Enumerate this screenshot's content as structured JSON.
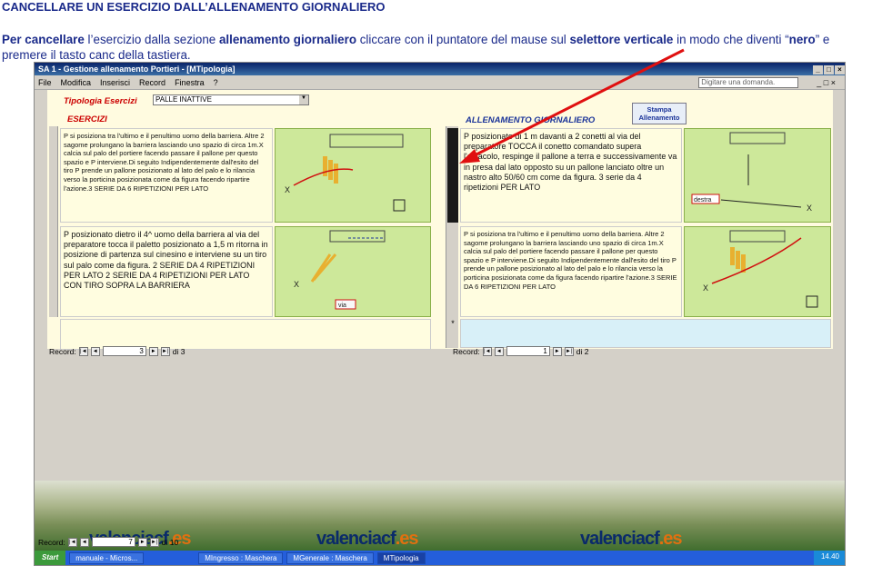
{
  "heading": "CANCELLARE UN ESERCIZIO DALL’ALLENAMENTO GIORNALIERO",
  "intro": {
    "p1": "Per cancellare",
    "p2": " l’esercizio dalla sezione ",
    "p3": "allenamento giornaliero",
    "p4": " cliccare con il puntatore del mause  sul ",
    "p5": "selettore verticale",
    "p6": " in modo che diventi “",
    "p7": "nero",
    "p8": "” e premere il tasto canc della tastiera."
  },
  "window": {
    "title": "SA 1 - Gestione allenamento Portieri - [MTipologia]",
    "menu": [
      "File",
      "Modifica",
      "Inserisci",
      "Record",
      "Finestra",
      "?"
    ],
    "help_placeholder": "Digitare una domanda."
  },
  "form": {
    "tipologia_label": "Tipologia Esercizi",
    "tipologia_value": "PALLE INATTIVE",
    "esercizi_label": "ESERCIZI",
    "allenamento_label": "ALLENAMENTO GIORNALIERO",
    "stampa_button": "Stampa Allenamento",
    "left_cells": [
      "P si posiziona tra l'ultimo e il penultimo uomo della barriera. Altre 2 sagome prolungano la barriera lasciando uno spazio di circa 1m.X calcia sul palo del portiere facendo passare il pallone per questo spazio e P interviene.Di seguito Indipendentemente dall'esito del tiro P prende un pallone posizionato al lato del palo e lo rilancia verso la porticina posizionata come da figura facendo ripartire l'azione.3 SERIE DA 6 RIPETIZIONI PER LATO",
      "P posizionato dietro il 4^ uomo della barriera al via del preparatore tocca il paletto posizionato a 1,5 m ritorna in posizione di partenza sul cinesino e interviene su un tiro sul palo come da figura. 2 SERIE DA 4 RIPETIZIONI PER LATO 2 SERIE DA 4 RIPETIZIONI PER LATO CON TIRO SOPRA LA BARRIERA"
    ],
    "right_cells": [
      "P posizionato di 1 m davanti a 2 conetti al via del preparatore TOCCA il conetto comandato supera l'ostacolo, respinge il pallone a terra e successivamente va in presa dal lato opposto su un pallone lanciato oltre un nastro alto 50/60 cm come da figura. 3 serie da 4 ripetizioni PER LATO",
      "P si posiziona tra l'ultimo e il penultimo uomo della barriera. Altre 2 sagome prolungano la barriera lasciando uno spazio di circa 1m.X calcia sul palo del portiere facendo passare il pallone per questo spazio e P interviene.Di seguito Indipendentemente dall'esito del tiro P prende un pallone posizionato al lato del palo e lo rilancia verso la porticina posizionata come da figura facendo ripartire l'azione.3 SERIE DA 6 RIPETIZIONI PER LATO"
    ],
    "img_labels": {
      "via": "via",
      "destra": "destra",
      "x": "X",
      "p": "P"
    },
    "new_row_marker": "*",
    "record_label": "Record:",
    "left_record": "3",
    "left_total": "di 3",
    "right_record": "1",
    "right_total": "di 2"
  },
  "bottom_record": {
    "label": "Record:",
    "value": "7",
    "total": "di 10"
  },
  "photo_banner": {
    "a": "valenciacf",
    "b": ".es"
  },
  "taskbar": {
    "start": "Start",
    "tasks": [
      "manuale - Micros...",
      "MIngresso : Maschera",
      "MGenerale : Maschera",
      "MTipologia"
    ],
    "clock": "14.40"
  },
  "colors": {
    "arrow": "#e01010",
    "title_blue": "#1a2a8a",
    "field_green": "#cde89a"
  }
}
